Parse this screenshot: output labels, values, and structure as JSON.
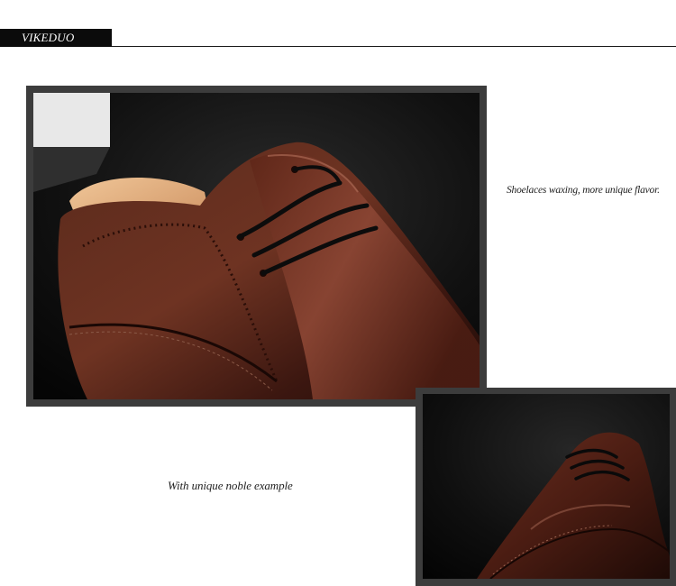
{
  "header": {
    "brand": "VIKEDUO"
  },
  "photos": [
    {
      "subject": "shoe-laces-closeup",
      "alt": ""
    },
    {
      "subject": "shoe-toe-closeup",
      "alt": ""
    }
  ],
  "captions": {
    "first": "Shoelaces waxing, more unique flavor.",
    "second": "With unique noble example"
  },
  "colors": {
    "header_bar": "#0b0b0b",
    "frame": "#3c3c3c",
    "leather": "#4a1e14",
    "background": "#ffffff"
  }
}
